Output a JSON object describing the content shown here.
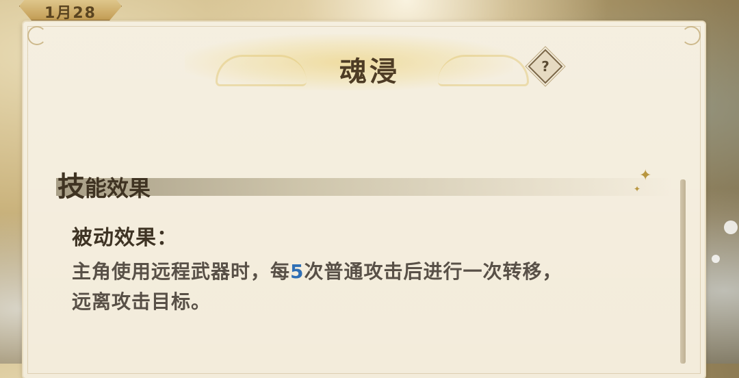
{
  "top_tab": {
    "label": "1月28"
  },
  "skill": {
    "name": "魂浸"
  },
  "help_button": {
    "symbol": "?"
  },
  "section": {
    "heading_first": "技",
    "heading_rest": "能效果"
  },
  "effect": {
    "label": "被动效果：",
    "desc_before": "主角使用远程武器时，每",
    "desc_highlight": "5",
    "desc_after": "次普通攻击后进行一次转移，",
    "desc_line2": "远离攻击目标。"
  },
  "colors": {
    "highlight": "#2f6fb5",
    "title_text": "#4e3c25",
    "body_text": "#585047",
    "parchment": "#f3ecdb"
  }
}
